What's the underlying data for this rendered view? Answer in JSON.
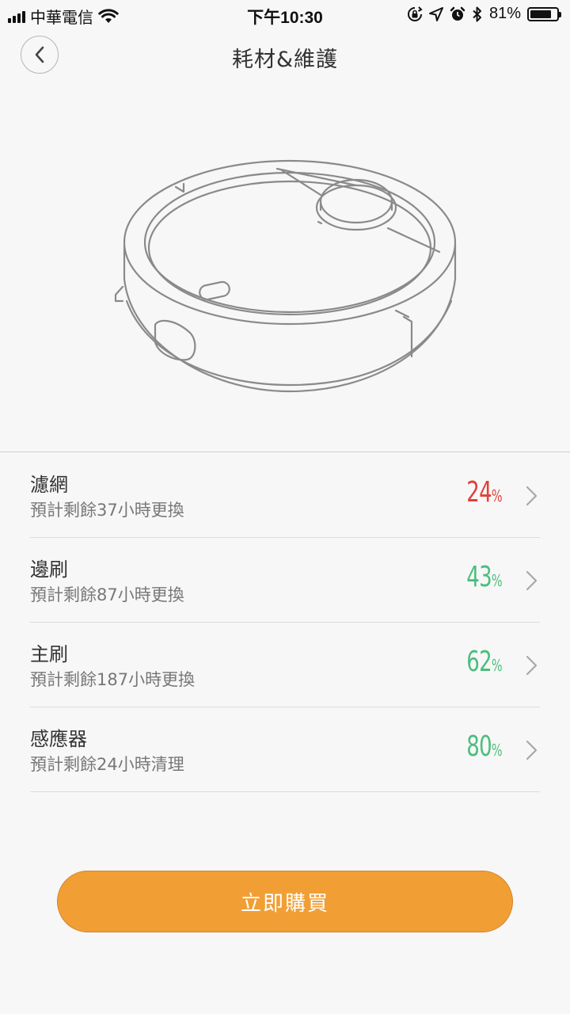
{
  "status_bar": {
    "carrier": "中華電信",
    "time": "下午10:30",
    "battery_percent": "81%",
    "battery_level": 0.81,
    "icons": [
      "signal-icon",
      "wifi-icon",
      "rotation-lock-icon",
      "location-icon",
      "alarm-icon",
      "bluetooth-icon",
      "battery-icon"
    ]
  },
  "nav": {
    "title": "耗材&維護",
    "back_icon": "chevron-left-icon"
  },
  "hero": {
    "image": "robot-vacuum-illustration"
  },
  "items": [
    {
      "name": "濾網",
      "subtitle": "預計剩餘37小時更換",
      "value": "24",
      "unit": "%",
      "color": "#e2403a"
    },
    {
      "name": "邊刷",
      "subtitle": "預計剩餘87小時更換",
      "value": "43",
      "unit": "%",
      "color": "#4cbd7e"
    },
    {
      "name": "主刷",
      "subtitle": "預計剩餘187小時更換",
      "value": "62",
      "unit": "%",
      "color": "#4cbd7e"
    },
    {
      "name": "感應器",
      "subtitle": "預計剩餘24小時清理",
      "value": "80",
      "unit": "%",
      "color": "#4cbd7e"
    }
  ],
  "buy_button": {
    "label": "立即購買",
    "color": "#f19f35"
  }
}
